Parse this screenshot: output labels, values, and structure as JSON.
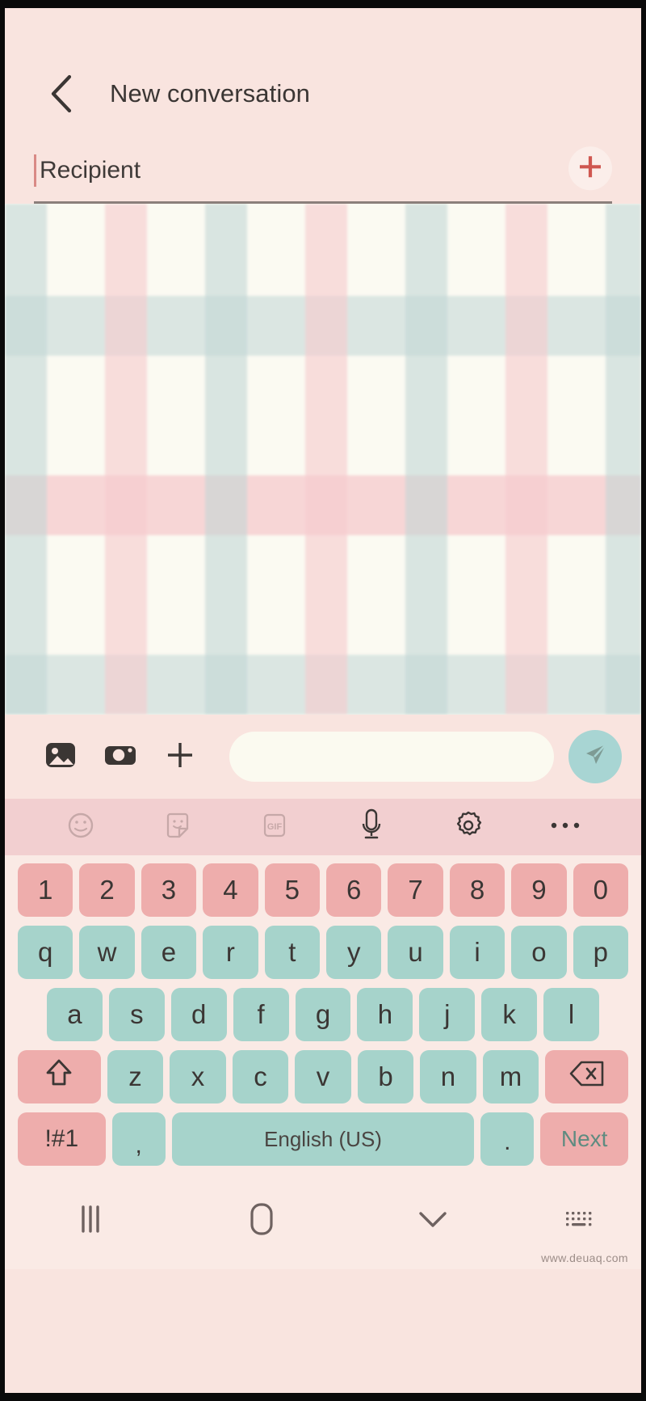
{
  "header": {
    "back_icon": "chevron-left-icon",
    "title": "New conversation"
  },
  "recipient": {
    "placeholder": "Recipient",
    "value": "",
    "add_icon": "plus-icon",
    "add_icon_color": "#cf5750"
  },
  "conversation": {
    "wallpaper": "plaid-pattern",
    "colors": {
      "base": "#fbfaf2",
      "mint": "#c1d6d5",
      "pink": "#f6cbce"
    },
    "messages": []
  },
  "compose": {
    "gallery_icon": "gallery-icon",
    "camera_icon": "camera-icon",
    "more_icon": "plus-icon",
    "input_value": "",
    "input_placeholder": "",
    "send_icon": "send-icon",
    "send_bg": "#a8d5d3"
  },
  "keyboard_toolbar": {
    "items": [
      {
        "name": "emoji-icon",
        "label": ""
      },
      {
        "name": "sticker-icon",
        "label": ""
      },
      {
        "name": "gif-icon",
        "label": "GIF"
      },
      {
        "name": "microphone-icon",
        "label": ""
      },
      {
        "name": "settings-gear-icon",
        "label": ""
      },
      {
        "name": "more-options-icon",
        "label": ""
      }
    ]
  },
  "keyboard": {
    "bg": "#faeae5",
    "num_key_color": "#eeadac",
    "letter_key_color": "#a6d3cb",
    "rows": {
      "numbers": [
        "1",
        "2",
        "3",
        "4",
        "5",
        "6",
        "7",
        "8",
        "9",
        "0"
      ],
      "letters1": [
        "q",
        "w",
        "e",
        "r",
        "t",
        "y",
        "u",
        "i",
        "o",
        "p"
      ],
      "letters2": [
        "a",
        "s",
        "d",
        "f",
        "g",
        "h",
        "j",
        "k",
        "l"
      ],
      "letters3": [
        "z",
        "x",
        "c",
        "v",
        "b",
        "n",
        "m"
      ],
      "shift_icon": "shift-icon",
      "backspace_icon": "backspace-icon"
    },
    "bottom_row": {
      "symbols_label": "!#1",
      "comma_label": ",",
      "space_label": "English (US)",
      "period_label": ".",
      "enter_label": "Next"
    }
  },
  "system_nav": {
    "recents_icon": "recents-icon",
    "home_icon": "home-icon",
    "hide_keyboard_icon": "chevron-down-icon",
    "switch_keyboard_icon": "keyboard-switch-icon"
  },
  "watermark": {
    "text": "www.deuaq.com"
  }
}
